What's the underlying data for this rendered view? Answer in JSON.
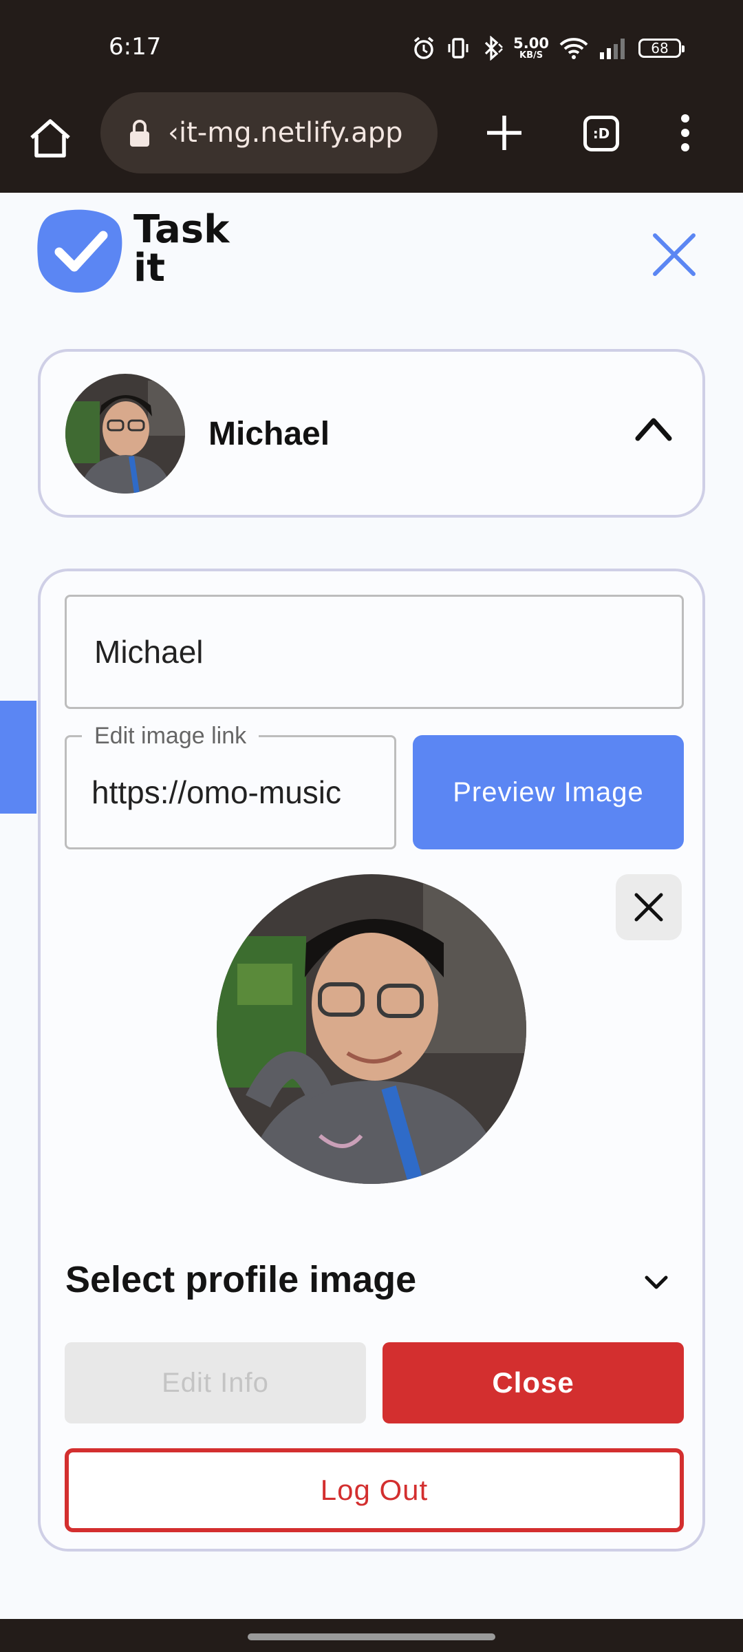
{
  "status_bar": {
    "time": "6:17",
    "net_speed_value": "5.00",
    "net_speed_unit": "KB/S",
    "battery": "68",
    "icons": [
      "alarm-icon",
      "vibrate-icon",
      "bluetooth-icon",
      "wifi-icon",
      "signal-icon",
      "battery-icon"
    ]
  },
  "browser": {
    "url": "‹it-mg.netlify.app",
    "tabs_label": ":D",
    "icons": [
      "home-icon",
      "lock-icon",
      "plus-icon",
      "tabs-icon",
      "more-vert-icon"
    ]
  },
  "header": {
    "brand_line1": "Task",
    "brand_line2": "it",
    "accent": "#5b86f3"
  },
  "user_card": {
    "name": "Michael"
  },
  "edit_form": {
    "name_value": "Michael",
    "image_link_label": "Edit image link",
    "image_link_value": "https://omo-music",
    "preview_label": "Preview Image",
    "select_label": "Select profile image",
    "edit_label": "Edit Info",
    "close_label": "Close",
    "logout_label": "Log Out"
  },
  "colors": {
    "primary": "#5b86f3",
    "danger": "#d32f2f",
    "disabled_bg": "#e8e8e8",
    "card_border": "#cfcfe6"
  }
}
